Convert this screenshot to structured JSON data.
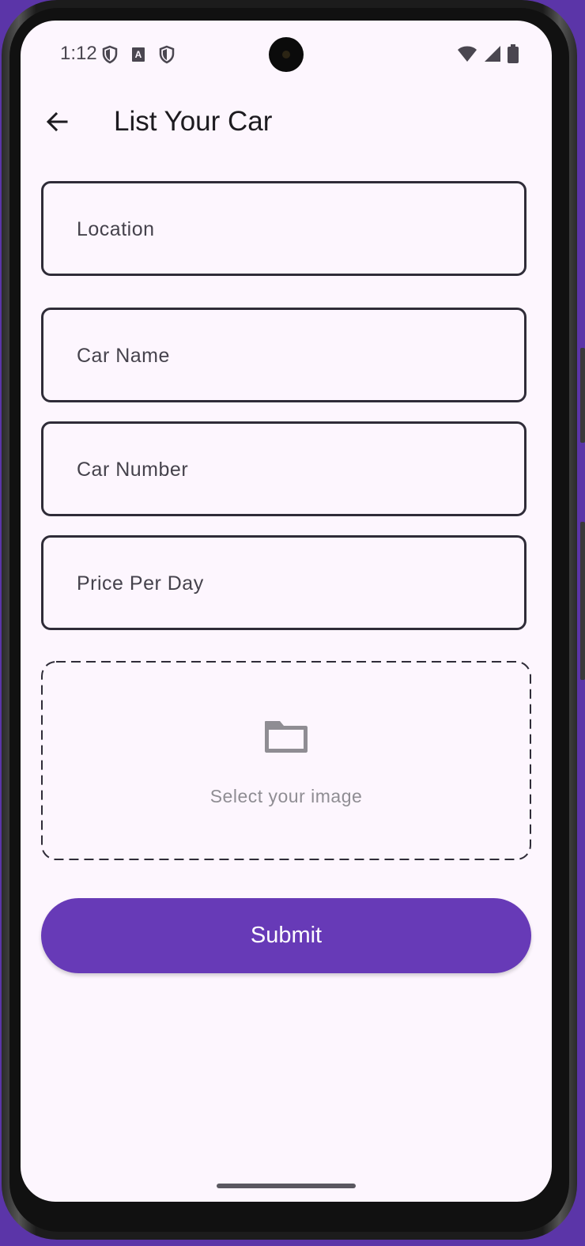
{
  "status_bar": {
    "time": "1:12",
    "left_icons": [
      "shield-icon",
      "a-box-icon",
      "shield-icon"
    ],
    "right_icons": [
      "wifi-icon",
      "cellular-signal-icon",
      "battery-icon"
    ]
  },
  "app_bar": {
    "back_icon": "arrow-back-icon",
    "title": "List Your Car"
  },
  "form": {
    "fields": [
      {
        "label": "Location"
      },
      {
        "label": "Car Name"
      },
      {
        "label": "Car Number"
      },
      {
        "label": "Price Per Day"
      }
    ],
    "image_picker": {
      "icon": "folder-icon",
      "label": "Select your image"
    },
    "submit_label": "Submit"
  },
  "colors": {
    "background": "#fdf6fe",
    "primary": "#673ab7",
    "field_border": "#2f2c38",
    "device_frame_bg": "#5b35a8"
  }
}
